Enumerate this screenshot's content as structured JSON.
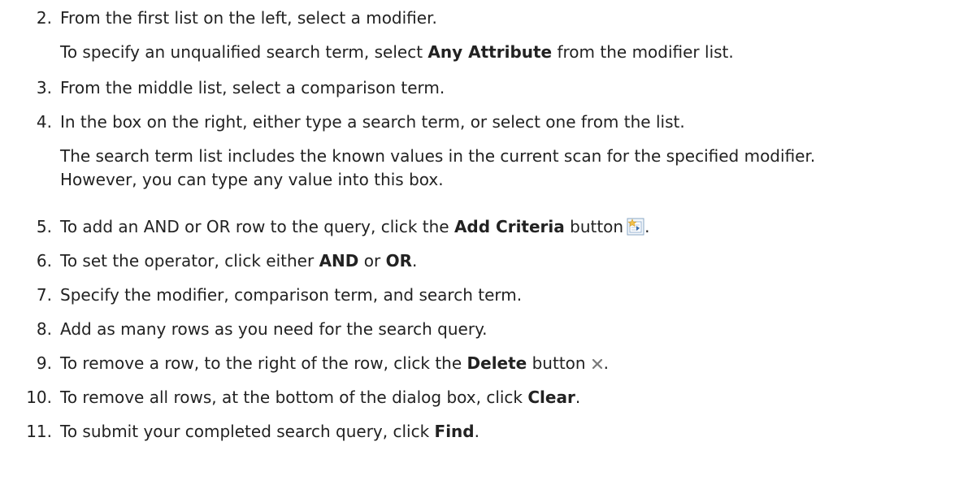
{
  "steps": [
    {
      "num": "2.",
      "text": "From the first list on the left, select a modifier."
    },
    {
      "num": "3.",
      "text": "From the middle list, select a comparison term."
    },
    {
      "num": "4.",
      "text": "In the box on the right, either type a search term, or select one from the list."
    },
    {
      "num": "5.",
      "pre": "To add an AND or OR row to the query, click the ",
      "bold": "Add Criteria",
      "post": " button",
      "icon": "add-criteria-icon",
      "tail": "."
    },
    {
      "num": "6.",
      "pre": "To set the operator, click either ",
      "bold": "AND",
      "mid": " or ",
      "bold2": "OR",
      "post": "."
    },
    {
      "num": "7.",
      "text": "Specify the modifier, comparison term, and search term."
    },
    {
      "num": "8.",
      "text": "Add as many rows as you need for the search query."
    },
    {
      "num": "9.",
      "pre": "To remove a row, to the right of the row, click the ",
      "bold": "Delete",
      "post": " button",
      "icon": "delete-x-icon",
      "tail": "."
    },
    {
      "num": "10.",
      "pre": "To remove all rows, at the bottom of the dialog box, click ",
      "bold": "Clear",
      "post": "."
    },
    {
      "num": "11.",
      "pre": "To submit your completed search query, click ",
      "bold": "Find",
      "post": "."
    }
  ],
  "notes": {
    "step2_pre": "To specify an unqualified search term, select ",
    "step2_bold": "Any Attribute",
    "step2_post": " from the modifier list.",
    "step4_line1": "The search term list includes the known values in the current scan for the specified modifier.",
    "step4_line2": "However, you can type any value into this box."
  },
  "colors": {
    "text": "#222222",
    "icon_add_bg": "#f3f7fb",
    "icon_add_border": "#8aa7c6",
    "icon_star": "#f2c14b",
    "icon_delete": "#7a7a7a"
  }
}
